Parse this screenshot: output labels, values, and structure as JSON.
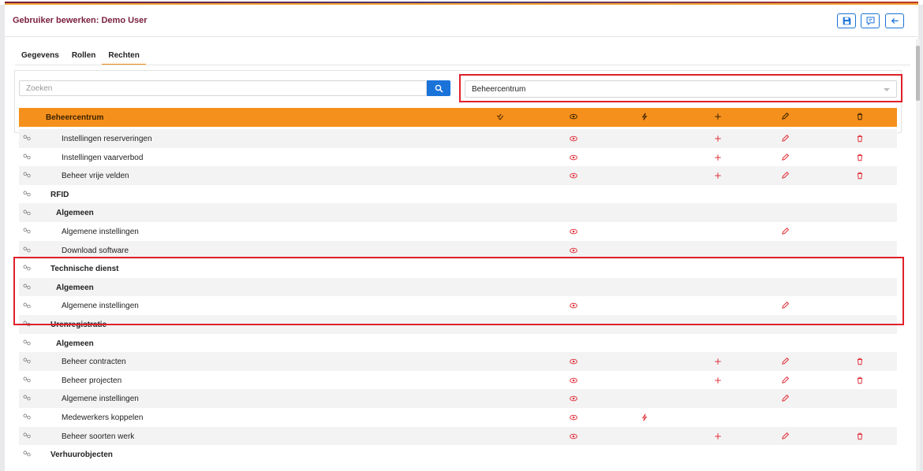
{
  "header": {
    "title": "Gebruiker bewerken: Demo User",
    "buttons": [
      {
        "name": "save-button",
        "icon": "save-icon"
      },
      {
        "name": "comment-button",
        "icon": "comment-icon"
      },
      {
        "name": "back-button",
        "icon": "arrow-left-icon"
      }
    ]
  },
  "tabs": [
    {
      "label": "Gegevens",
      "active": false
    },
    {
      "label": "Rollen",
      "active": false
    },
    {
      "label": "Rechten",
      "active": true
    }
  ],
  "search": {
    "placeholder": "Zoeken",
    "value": ""
  },
  "module_select": {
    "selected": "Beheercentrum"
  },
  "table_header": {
    "label": "Beheercentrum",
    "columns": [
      "check-all-icon",
      "view-icon",
      "execute-icon",
      "add-icon",
      "edit-icon",
      "delete-icon"
    ]
  },
  "rows": [
    {
      "label": "Instellingen reserveringen",
      "level": 2,
      "perms": [
        "view",
        "add",
        "edit",
        "delete"
      ]
    },
    {
      "label": "Instellingen vaarverbod",
      "level": 2,
      "perms": [
        "view",
        "add",
        "edit",
        "delete"
      ]
    },
    {
      "label": "Beheer vrije velden",
      "level": 2,
      "perms": [
        "view",
        "add",
        "edit",
        "delete"
      ]
    },
    {
      "label": "RFID",
      "level": 0,
      "perms": []
    },
    {
      "label": "Algemeen",
      "level": 1,
      "perms": []
    },
    {
      "label": "Algemene instellingen",
      "level": 2,
      "perms": [
        "view",
        "edit"
      ]
    },
    {
      "label": "Download software",
      "level": 2,
      "perms": [
        "view"
      ]
    },
    {
      "label": "Technische dienst",
      "level": 0,
      "perms": []
    },
    {
      "label": "Algemeen",
      "level": 1,
      "perms": []
    },
    {
      "label": "Algemene instellingen",
      "level": 2,
      "perms": [
        "view",
        "edit"
      ]
    },
    {
      "label": "Urenregistratie",
      "level": 0,
      "perms": []
    },
    {
      "label": "Algemeen",
      "level": 1,
      "perms": []
    },
    {
      "label": "Beheer contracten",
      "level": 2,
      "perms": [
        "view",
        "add",
        "edit",
        "delete"
      ]
    },
    {
      "label": "Beheer projecten",
      "level": 2,
      "perms": [
        "view",
        "add",
        "edit",
        "delete"
      ]
    },
    {
      "label": "Algemene instellingen",
      "level": 2,
      "perms": [
        "view",
        "edit"
      ]
    },
    {
      "label": "Medewerkers koppelen",
      "level": 2,
      "perms": [
        "view",
        "execute"
      ]
    },
    {
      "label": "Beheer soorten werk",
      "level": 2,
      "perms": [
        "view",
        "add",
        "edit",
        "delete"
      ]
    },
    {
      "label": "Verhuurobjecten",
      "level": 0,
      "perms": []
    }
  ],
  "colors": {
    "accent": "#f6901c",
    "primary": "#1a73d9",
    "title": "#7a1f3e",
    "highlight": "#e0202a",
    "perm_icon": "#e0303a"
  }
}
